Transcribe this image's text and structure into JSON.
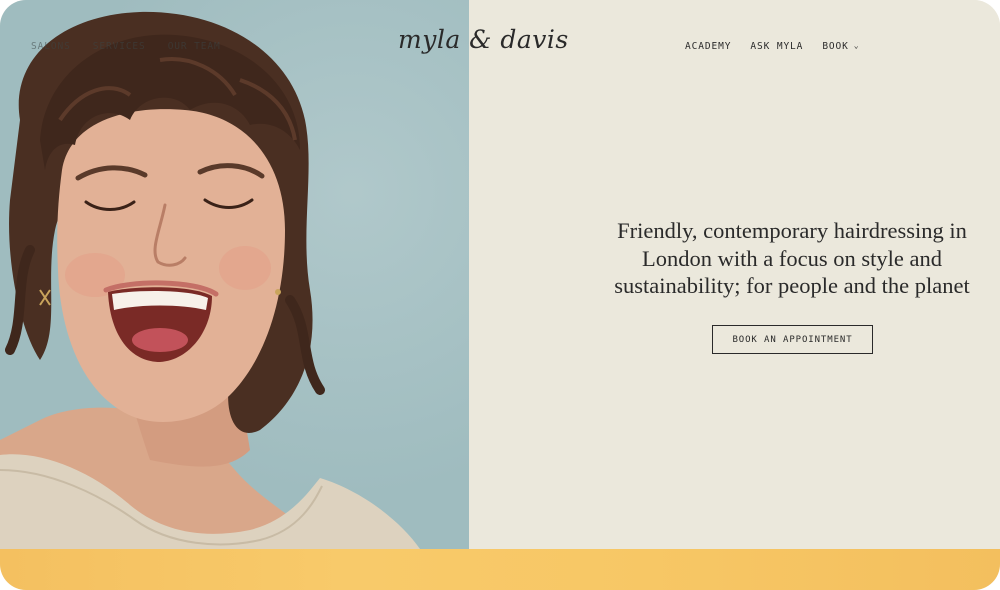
{
  "nav": {
    "left_items": [
      {
        "label": "SALONS"
      },
      {
        "label": "SERVICES"
      },
      {
        "label": "OUR TEAM"
      }
    ],
    "right_items": [
      {
        "label": "ACADEMY"
      },
      {
        "label": "ASK MYLA"
      },
      {
        "label": "BOOK"
      }
    ]
  },
  "brand": {
    "logo_text": "myla & davis"
  },
  "hero": {
    "headline": "Friendly, contemporary hairdressing in London with a focus on style and sustainability; for people and the planet",
    "cta_label": "BOOK AN APPOINTMENT",
    "photo_alt": "Smiling person with curly brown hair"
  },
  "colors": {
    "panel_bg": "#ebe8dc",
    "photo_bg": "#9fbcbf",
    "accent_strip": "#f7c765",
    "text": "#2a2a2a"
  },
  "icons": {
    "dropdown": "chevron-down-icon"
  }
}
